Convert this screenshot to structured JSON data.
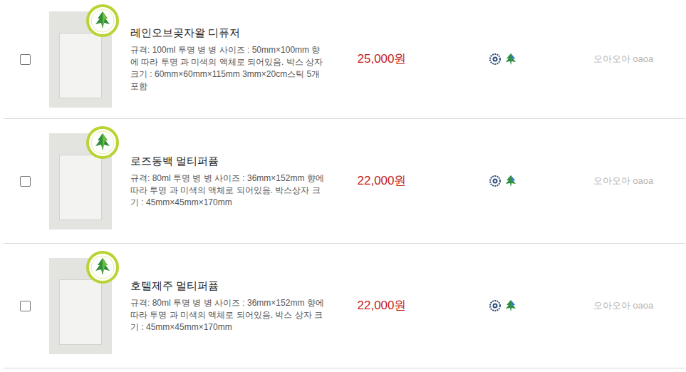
{
  "products": [
    {
      "name": "레인오브곶자왈 디퓨저",
      "spec": "규격: 100ml 투명 병 병 사이즈 : 50mm×100mm 향에 따라 투명 과 미색의 액체로 되어있음. 박스 상자 크기 : 60mm×60mm×115mm 3mm×20cm스틱 5개 포함",
      "price": "25,000원",
      "seller": "오아오아 oaoa",
      "checked": false
    },
    {
      "name": "로즈동백 멀티퍼퓸",
      "spec": "규격: 80ml 투명 병 병 사이즈 : 36mm×152mm 향에 따라 투명 과 미색의 액체로 되어있음. 박스상자 크기 : 45mm×45mm×170mm",
      "price": "22,000원",
      "seller": "오아오아 oaoa",
      "checked": false
    },
    {
      "name": "호텔제주 멀티퍼퓸",
      "spec": "규격: 80ml 투명 병 병 사이즈 : 36mm×152mm 향에 따라 투명 과 미색의 액체로 되어있음. 박스 상자 크기 : 45mm×45mm×170mm",
      "price": "22,000원",
      "seller": "오아오아 oaoa",
      "checked": false
    }
  ]
}
